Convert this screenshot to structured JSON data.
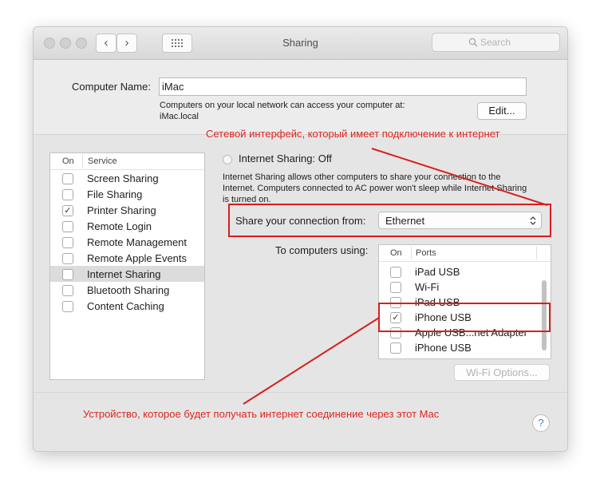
{
  "window": {
    "title": "Sharing"
  },
  "search": {
    "placeholder": "Search"
  },
  "computer_name": {
    "label": "Computer Name:",
    "value": "iMac",
    "info_line1": "Computers on your local network can access your computer at:",
    "info_line2": "iMac.local",
    "edit_button": "Edit..."
  },
  "services": {
    "header_on": "On",
    "header_service": "Service",
    "items": [
      {
        "label": "Screen Sharing",
        "checked": false
      },
      {
        "label": "File Sharing",
        "checked": false
      },
      {
        "label": "Printer Sharing",
        "checked": true
      },
      {
        "label": "Remote Login",
        "checked": false
      },
      {
        "label": "Remote Management",
        "checked": false
      },
      {
        "label": "Remote Apple Events",
        "checked": false
      },
      {
        "label": "Internet Sharing",
        "checked": false,
        "selected": true
      },
      {
        "label": "Bluetooth Sharing",
        "checked": false
      },
      {
        "label": "Content Caching",
        "checked": false
      }
    ]
  },
  "internet_sharing": {
    "status": "Internet Sharing: Off",
    "description": "Internet Sharing allows other computers to share your connection to the Internet. Computers connected to AC power won't sleep while Internet Sharing is turned on.",
    "share_from_label": "Share your connection from:",
    "share_from_value": "Ethernet",
    "to_computers_label": "To computers using:",
    "ports_header_on": "On",
    "ports_header_ports": "Ports",
    "ports": [
      {
        "label": "iPad USB",
        "checked": false
      },
      {
        "label": "Wi-Fi",
        "checked": false
      },
      {
        "label": "iPad USB",
        "checked": false
      },
      {
        "label": "iPhone USB",
        "checked": true
      },
      {
        "label": "Apple USB...net Adapter",
        "checked": false
      },
      {
        "label": "iPhone USB",
        "checked": false
      }
    ],
    "wifi_options_button": "Wi-Fi Options..."
  },
  "help_button": "?",
  "annotations": {
    "top": "Сетевой интерфейс, который имеет подключение к интернет",
    "bottom": "Устройство, которое будет получать интернет соединение через этот Mac"
  },
  "colors": {
    "annotation_red": "#e0241f",
    "selection_gray": "#dcdcdc"
  },
  "icons": [
    "back-chevron-icon",
    "forward-chevron-icon",
    "grid-icon",
    "search-icon",
    "checkmark-icon",
    "stepper-icon",
    "help-icon"
  ]
}
